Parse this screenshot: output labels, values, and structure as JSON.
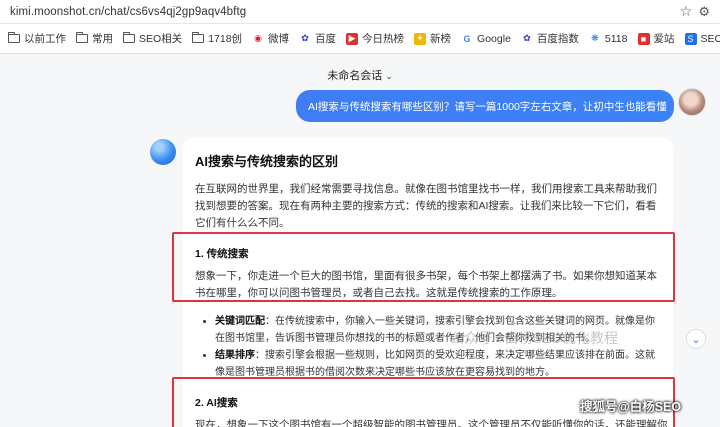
{
  "browser": {
    "url": "kimi.moonshot.cn/chat/cs6vs4qj2gp9aqv4bftg",
    "bookmarks": [
      {
        "label": "以前工作",
        "icon": "folder-icon"
      },
      {
        "label": "常用",
        "icon": "folder-icon"
      },
      {
        "label": "SEO相关",
        "icon": "folder-icon"
      },
      {
        "label": "1718创",
        "icon": "folder-icon"
      },
      {
        "label": "微博",
        "icon": "weibo-icon",
        "color": "#e6162d"
      },
      {
        "label": "百度",
        "icon": "baidu-icon",
        "color": "#2932e1"
      },
      {
        "label": "今日热榜",
        "icon": "hot-list-icon",
        "color": "#e03131"
      },
      {
        "label": "新榜",
        "icon": "xinbang-icon",
        "color": "#f2b705"
      },
      {
        "label": "Google",
        "icon": "google-icon",
        "color": "#4285f4"
      },
      {
        "label": "百度指数",
        "icon": "baidu-index-icon",
        "color": "#2932e1"
      },
      {
        "label": "5118",
        "icon": "5118-icon",
        "color": "#1f6feb"
      },
      {
        "label": "爱站",
        "icon": "aizhan-icon",
        "color": "#e03131"
      },
      {
        "label": "SEO查询",
        "icon": "seo-query-icon",
        "color": "#1f6feb"
      }
    ]
  },
  "chat": {
    "conversation_title": "未命名会话",
    "user_message": "AI搜索与传统搜索有哪些区别？请写一篇1000字左右文章，让初中生也能看懂",
    "answer": {
      "title": "AI搜索与传统搜索的区别",
      "intro": "在互联网的世界里，我们经常需要寻找信息。就像在图书馆里找书一样，我们用搜索工具来帮助我们找到想要的答案。现在有两种主要的搜索方式：传统的搜索和AI搜索。让我们来比较一下它们，看看它们有什么么不同。",
      "section1_head": "1. 传统搜索",
      "section1_body": "想象一下，你走进一个巨大的图书馆，里面有很多书架，每个书架上都摆满了书。如果你想知道某本书在哪里，你可以问图书管理员，或者自己去找。这就是传统搜索的工作原理。",
      "bullet1_label": "关键词匹配",
      "bullet1_text": "：在传统搜索中，你输入一些关键词，搜索引擎会找到包含这些关键词的网页。就像是你在图书馆里，告诉图书管理员你想找的书的标题或者作者，他们会帮你找到相关的书。",
      "bullet2_label": "结果排序",
      "bullet2_text": "：搜索引擎会根据一些规则，比如网页的受欢迎程度，来决定哪些结果应该排在前面。这就像是图书管理员根据书的借阅次数来决定哪些书应该放在更容易找到的地方。",
      "section2_head": "2. AI搜索",
      "section2_body": "现在，想象一下这个图书馆有一个超级智能的图书管理员。这个管理员不仅能听懂你的话，还能理解你"
    }
  },
  "overlay": {
    "watermark": "公众号 · 白杨SEO优化教程",
    "watermark2": "搜狐号@白杨SEO"
  },
  "colors": {
    "highlight_border": "#e0323f",
    "user_bubble": "#3f7df5"
  }
}
